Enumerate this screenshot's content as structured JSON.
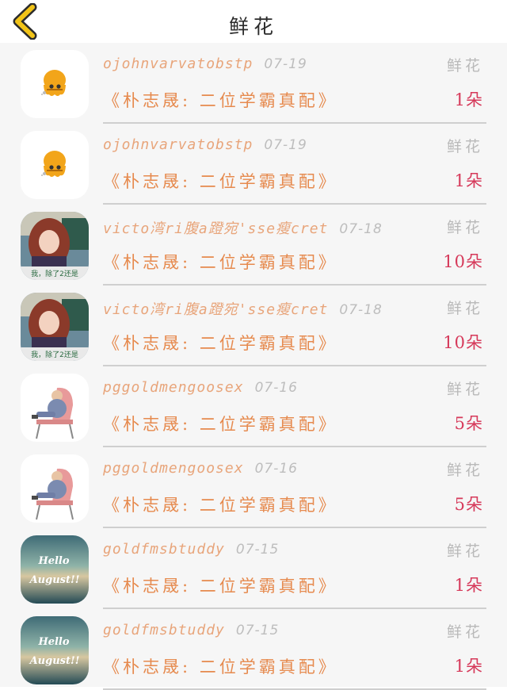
{
  "header": {
    "title": "鲜花",
    "back_icon": "chevron-left-icon",
    "accent_color": "#f2c418"
  },
  "rows": [
    {
      "username": "ojohnvarvatobstp",
      "date": "07-19",
      "gift_type": "鲜花",
      "book_title": "《朴志晟: 二位学霸真配》",
      "quantity": "1朵",
      "avatar": "cartoon-octopus"
    },
    {
      "username": "ojohnvarvatobstp",
      "date": "07-19",
      "gift_type": "鲜花",
      "book_title": "《朴志晟: 二位学霸真配》",
      "quantity": "1朵",
      "avatar": "cartoon-octopus"
    },
    {
      "username": "victo湾ri腹a蹬宛'sse瘦cret",
      "date": "07-18",
      "gift_type": "鲜花",
      "book_title": "《朴志晟: 二位学霸真配》",
      "quantity": "10朵",
      "avatar": "girl-photo"
    },
    {
      "username": "victo湾ri腹a蹬宛'sse瘦cret",
      "date": "07-18",
      "gift_type": "鲜花",
      "book_title": "《朴志晟: 二位学霸真配》",
      "quantity": "10朵",
      "avatar": "girl-photo"
    },
    {
      "username": "pggoldmengoosex",
      "date": "07-16",
      "gift_type": "鲜花",
      "book_title": "《朴志晟: 二位学霸真配》",
      "quantity": "5朵",
      "avatar": "man-in-chair"
    },
    {
      "username": "pggoldmengoosex",
      "date": "07-16",
      "gift_type": "鲜花",
      "book_title": "《朴志晟: 二位学霸真配》",
      "quantity": "5朵",
      "avatar": "man-in-chair"
    },
    {
      "username": "goldfmsbtuddy",
      "date": "07-15",
      "gift_type": "鲜花",
      "book_title": "《朴志晟: 二位学霸真配》",
      "quantity": "1朵",
      "avatar": "hello-august"
    },
    {
      "username": "goldfmsbtuddy",
      "date": "07-15",
      "gift_type": "鲜花",
      "book_title": "《朴志晟: 二位学霸真配》",
      "quantity": "1朵",
      "avatar": "hello-august"
    }
  ],
  "avatar_texts": {
    "girl_caption": "我，除了2还是",
    "hello": "Hello",
    "august": "August!!"
  },
  "colors": {
    "username": "#e8a57b",
    "book_title": "#e68a4e",
    "quantity": "#d6395a",
    "muted": "#b9b9b9"
  }
}
